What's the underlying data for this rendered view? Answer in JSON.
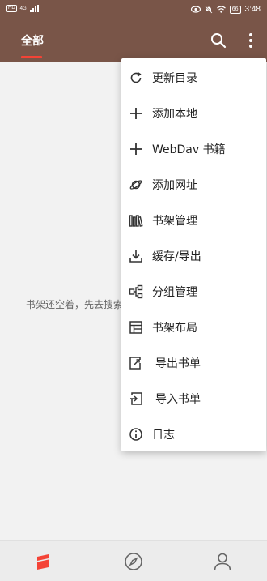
{
  "status_bar": {
    "hd_badge": "HD",
    "network": "4G",
    "battery": "66",
    "time": "3:48"
  },
  "app_bar": {
    "tab_all": "全部",
    "icons": [
      "search-icon",
      "more-vert-icon"
    ]
  },
  "main": {
    "empty_hint": "书架还空着，先去搜索"
  },
  "menu": {
    "items": [
      {
        "label": "更新目录",
        "icon": "refresh-icon"
      },
      {
        "label": "添加本地",
        "icon": "plus-icon"
      },
      {
        "label": "WebDav 书籍",
        "icon": "plus-icon"
      },
      {
        "label": "添加网址",
        "icon": "planet-icon"
      },
      {
        "label": "书架管理",
        "icon": "books-icon"
      },
      {
        "label": "缓存/导出",
        "icon": "download-icon"
      },
      {
        "label": "分组管理",
        "icon": "group-icon"
      },
      {
        "label": "书架布局",
        "icon": "layout-icon"
      },
      {
        "label": "导出书单",
        "icon": "export-icon"
      },
      {
        "label": "导入书单",
        "icon": "import-icon"
      },
      {
        "label": "日志",
        "icon": "info-icon"
      }
    ]
  },
  "bottom_nav": {
    "items": [
      "bookshelf-icon",
      "compass-icon",
      "person-icon"
    ]
  },
  "colors": {
    "primary": "#795548",
    "accent": "#f44336",
    "background": "#f2f2f2"
  }
}
